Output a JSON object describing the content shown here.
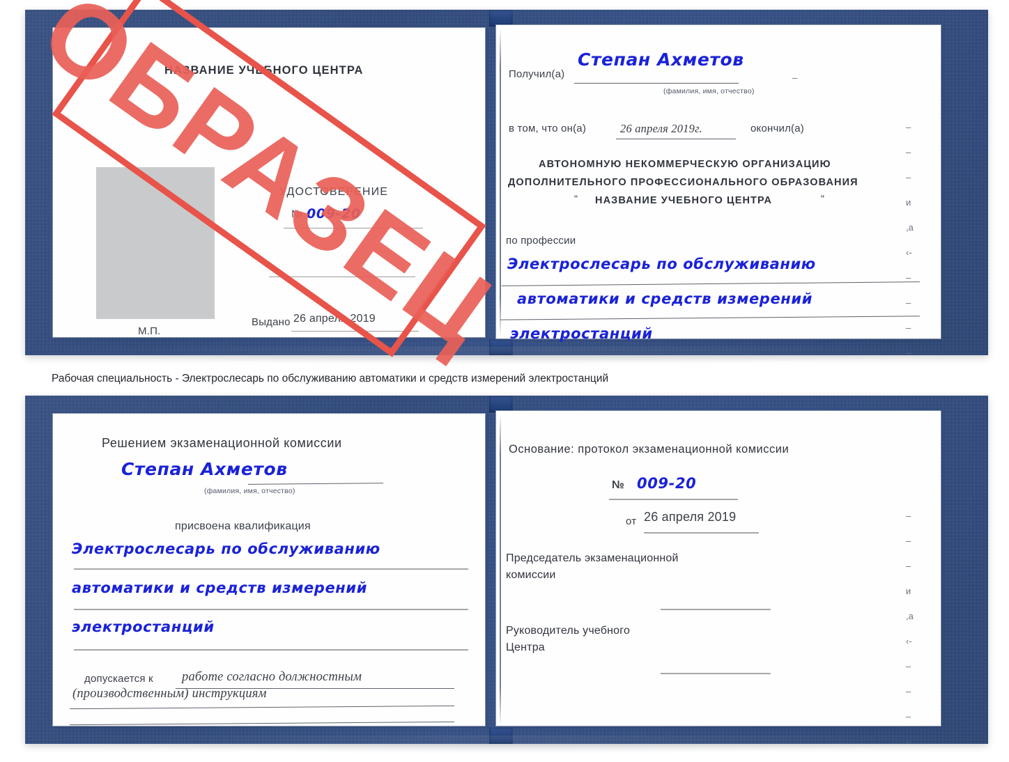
{
  "caption": "Рабочая специальность - Электрослесарь по обслуживанию автоматики и средств измерений электростанций",
  "watermark": {
    "text": "ОБРАЗЕЦ",
    "color": "#ea6058"
  },
  "colors": {
    "cover": "#20407c",
    "ink": "#1a22d8",
    "stamp": "#ea6058",
    "paper": "#fefefe"
  },
  "certificate_top": {
    "left_page": {
      "center_name": "НАЗВАНИЕ УЧЕБНОГО ЦЕНТРА",
      "doc_title": "УДОСТОВЕРЕНИЕ",
      "number_label": "№",
      "number_value": "009-20",
      "issued_label": "Выдано",
      "issued_value": "26 апреля 2019",
      "seal_label": "М.П."
    },
    "right_page": {
      "received_label": "Получил(а)",
      "received_value": "Степан Ахметов",
      "fio_hint": "(фамилия, имя, отчество)",
      "completed_prefix": "в том, что он(а)",
      "completed_date": "26 апреля 2019г.",
      "completed_suffix": "окончил(а)",
      "org_line1": "АВТОНОМНУЮ НЕКОММЕРЧЕСКУЮ ОРГАНИЗАЦИЮ",
      "org_line2": "ДОПОЛНИТЕЛЬНОГО ПРОФЕССИОНАЛЬНОГО ОБРАЗОВАНИЯ",
      "org_quote_open": "\"",
      "org_line3": "НАЗВАНИЕ УЧЕБНОГО ЦЕНТРА",
      "org_quote_close": "\"",
      "profession_label": "по профессии",
      "profession_line1": "Электрослесарь по обслуживанию",
      "profession_line2": "автоматики и средств измерений",
      "profession_line3": "электростанций",
      "margin_glyphs": [
        "–",
        "–",
        "–",
        "и",
        ",а",
        "‹-",
        "–",
        "–",
        "–",
        "–"
      ]
    }
  },
  "certificate_bottom": {
    "left_page": {
      "heading": "Решением экзаменационной комиссии",
      "name_value": "Степан Ахметов",
      "fio_hint": "(фамилия, имя, отчество)",
      "qualification_label": "присвоена квалификация",
      "qualification_line1": "Электрослесарь по обслуживанию",
      "qualification_line2": "автоматики и средств измерений",
      "qualification_line3": "электростанций",
      "admitted_label": "допускается к",
      "admitted_line1": "работе согласно должностным",
      "admitted_line2": "(производственным) инструкциям"
    },
    "right_page": {
      "basis_label": "Основание: протокол экзаменационной комиссии",
      "number_label": "№",
      "number_value": "009-20",
      "date_label": "от",
      "date_value": "26 апреля 2019",
      "chairman_line1": "Председатель экзаменационной",
      "chairman_line2": "комиссии",
      "head_line1": "Руководитель учебного",
      "head_line2": "Центра",
      "margin_glyphs": [
        "–",
        "–",
        "–",
        "и",
        ",а",
        "‹-",
        "–",
        "–",
        "–",
        "–"
      ]
    }
  }
}
